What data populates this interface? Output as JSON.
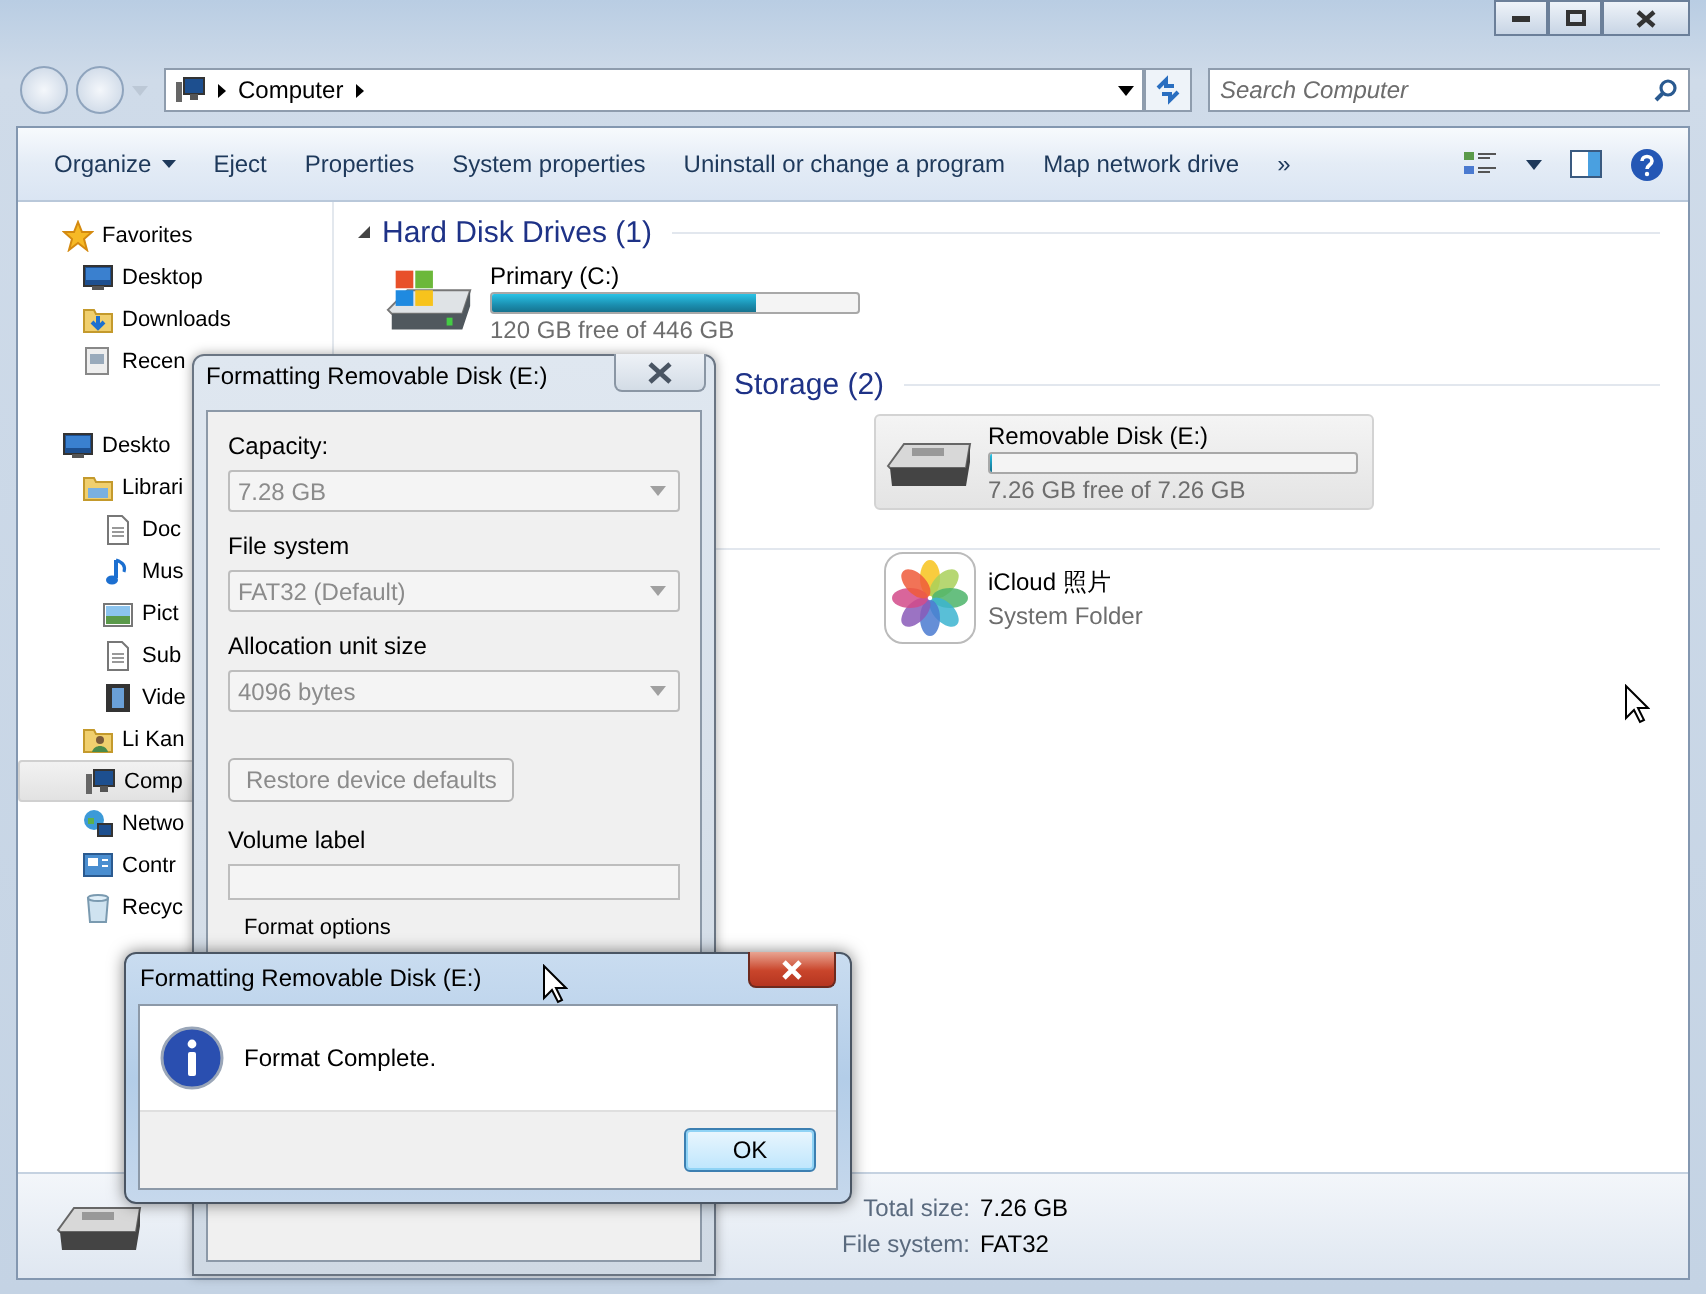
{
  "explorer": {
    "address": {
      "crumbs": [
        "Computer"
      ]
    },
    "search": {
      "placeholder": "Search Computer"
    },
    "toolbar": [
      {
        "label": "Organize",
        "kind": "menu"
      },
      {
        "label": "Eject",
        "kind": "button"
      },
      {
        "label": "Properties",
        "kind": "button"
      },
      {
        "label": "System properties",
        "kind": "button"
      },
      {
        "label": "Uninstall or change a program",
        "kind": "button"
      },
      {
        "label": "Map network drive",
        "kind": "button"
      },
      {
        "label": "»",
        "kind": "more"
      }
    ],
    "sidebar": {
      "items": [
        {
          "label": "Favorites",
          "kind": "star",
          "selected": false,
          "children": [
            {
              "label": "Desktop",
              "kind": "monitor",
              "selected": false
            },
            {
              "label": "Downloads",
              "kind": "download",
              "selected": false
            },
            {
              "label": "Recen",
              "kind": "recent",
              "selected": false
            }
          ]
        },
        {
          "label": "Deskto",
          "kind": "monitor",
          "selected": false,
          "children": [
            {
              "label": "Librari",
              "kind": "folder",
              "selected": false,
              "children": [
                {
                  "label": "Doc",
                  "kind": "document",
                  "selected": false
                },
                {
                  "label": "Mus",
                  "kind": "music",
                  "selected": false
                },
                {
                  "label": "Pict",
                  "kind": "image",
                  "selected": false
                },
                {
                  "label": "Sub",
                  "kind": "document",
                  "selected": false
                },
                {
                  "label": "Vide",
                  "kind": "film",
                  "selected": false
                }
              ]
            },
            {
              "label": "Li Kan",
              "kind": "user",
              "selected": false
            },
            {
              "label": "Comp",
              "kind": "computer",
              "selected": true
            },
            {
              "label": "Netwo",
              "kind": "network",
              "selected": false
            },
            {
              "label": "Contr",
              "kind": "panel",
              "selected": false
            },
            {
              "label": "Recyc",
              "kind": "bin",
              "selected": false
            }
          ]
        }
      ]
    },
    "groups": [
      {
        "title": "Hard Disk Drives (1)",
        "items": [
          {
            "kind": "drive",
            "name": "Primary (C:)",
            "level": 0.72,
            "detail": "120 GB free of 446 GB",
            "selected": false
          }
        ]
      },
      {
        "title": "Storage (2)",
        "items": [
          {
            "kind": "removable",
            "name": "Removable Disk (E:)",
            "level": 0.0,
            "detail": "7.26 GB free of 7.26 GB",
            "selected": true
          }
        ]
      },
      {
        "items": [
          {
            "kind": "photos",
            "name": "iCloud 照片",
            "detail": "System Folder",
            "selected": false
          }
        ]
      }
    ],
    "details": {
      "fields": [
        {
          "label": "Total size:",
          "value": "7.26 GB"
        },
        {
          "label": "File system:",
          "value": "FAT32"
        }
      ]
    }
  },
  "format_dialog": {
    "title": "Formatting Removable Disk (E:)",
    "fields": [
      {
        "label": "Capacity:",
        "value": "7.28 GB",
        "disabled": true
      },
      {
        "label": "File system",
        "value": "FAT32 (Default)",
        "disabled": true
      },
      {
        "label": "Allocation unit size",
        "value": "4096 bytes",
        "disabled": true
      }
    ],
    "restore_button": {
      "label": "Restore device defaults",
      "disabled": true
    },
    "volume_label": {
      "label": "Volume label",
      "disabled": true
    },
    "options_label": "Format options"
  },
  "message_box": {
    "title": "Formatting Removable Disk (E:)",
    "message": "Format Complete.",
    "buttons": [
      {
        "label": "OK",
        "default": true
      }
    ]
  }
}
